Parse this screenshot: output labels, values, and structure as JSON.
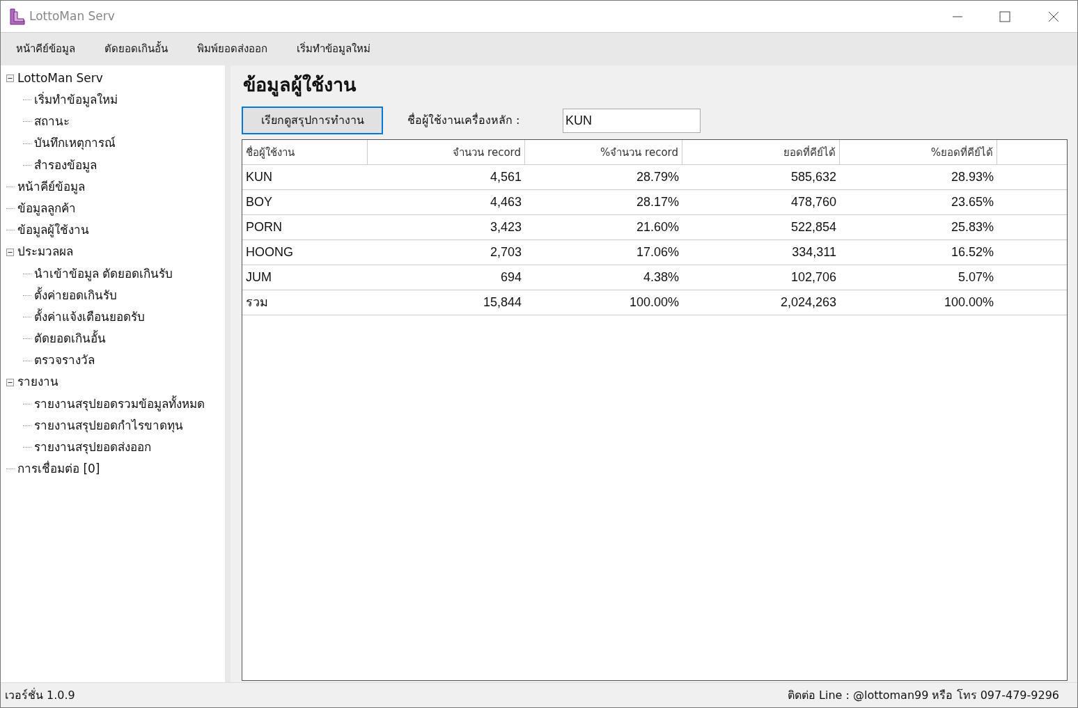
{
  "window": {
    "title": "LottoMan Serv"
  },
  "menu": [
    "หน้าคีย์ข้อมูล",
    "ตัดยอดเกินอั้น",
    "พิมพ์ยอดส่งออก",
    "เริ่มทำข้อมูลใหม่"
  ],
  "tree": [
    {
      "label": "LottoMan Serv",
      "expanded": true,
      "children": [
        {
          "label": "เริ่มทำข้อมูลใหม่"
        },
        {
          "label": "สถานะ"
        },
        {
          "label": "บันทึกเหตุการณ์"
        },
        {
          "label": "สำรองข้อมูล"
        }
      ]
    },
    {
      "label": "หน้าคีย์ข้อมูล"
    },
    {
      "label": "ข้อมูลลูกค้า"
    },
    {
      "label": "ข้อมูลผู้ใช้งาน"
    },
    {
      "label": "ประมวลผล",
      "expanded": true,
      "children": [
        {
          "label": "นำเข้าข้อมูล ตัดยอดเกินรับ"
        },
        {
          "label": "ตั้งค่ายอดเกินรับ"
        },
        {
          "label": "ตั้งค่าแจ้งเตือนยอดรับ"
        },
        {
          "label": "ตัดยอดเกินอั้น"
        },
        {
          "label": "ตรวจรางวัล"
        }
      ]
    },
    {
      "label": "รายงาน",
      "expanded": true,
      "children": [
        {
          "label": "รายงานสรุปยอดรวมข้อมูลทั้งหมด"
        },
        {
          "label": "รายงานสรุปยอดกำไรขาดทุน"
        },
        {
          "label": "รายงานสรุปยอดส่งออก"
        }
      ]
    },
    {
      "label": "การเชื่อมต่อ [0]"
    }
  ],
  "page_title": "ข้อมูลผู้ใช้งาน",
  "summary_button": "เรียกดูสรุปการทำงาน",
  "main_user": {
    "label": "ชื่อผู้ใช้งานเครื่องหลัก :",
    "value": "KUN"
  },
  "table": {
    "columns": [
      "ชื่อผู้ใช้งาน",
      "จำนวน record",
      "%จำนวน record",
      "ยอดที่คีย์ได้",
      "%ยอดที่คีย์ได้"
    ],
    "rows": [
      [
        "KUN",
        "4,561",
        "28.79%",
        "585,632",
        "28.93%"
      ],
      [
        "BOY",
        "4,463",
        "28.17%",
        "478,760",
        "23.65%"
      ],
      [
        "PORN",
        "3,423",
        "21.60%",
        "522,854",
        "25.83%"
      ],
      [
        "HOONG",
        "2,703",
        "17.06%",
        "334,311",
        "16.52%"
      ],
      [
        "JUM",
        "694",
        "4.38%",
        "102,706",
        "5.07%"
      ],
      [
        "รวม",
        "15,844",
        "100.00%",
        "2,024,263",
        "100.00%"
      ]
    ]
  },
  "status_bar": {
    "version": "เวอร์ชั่น 1.0.9",
    "contact": "ติดต่อ Line : @lottoman99 หรือ โทร 097-479-9296"
  }
}
